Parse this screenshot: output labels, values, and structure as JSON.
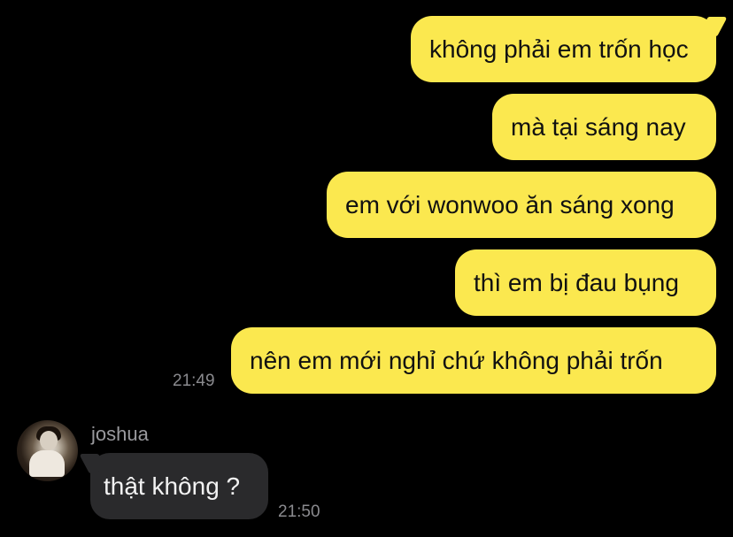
{
  "chat": {
    "outgoing": [
      {
        "text": "không phải em trốn học"
      },
      {
        "text": "mà tại sáng nay"
      },
      {
        "text": "em với wonwoo ăn sáng xong"
      },
      {
        "text": "thì em bị đau bụng"
      },
      {
        "text": "nên em mới nghỉ chứ không phải trốn"
      }
    ],
    "outgoing_time": "21:49",
    "incoming": {
      "sender": "joshua",
      "text": "thật không ?",
      "time": "21:50"
    }
  },
  "colors": {
    "background": "#000000",
    "outgoing_bubble": "#FBE84F",
    "incoming_bubble": "#2A2A2C",
    "timestamp": "#8A8A8E"
  },
  "icons": {
    "avatar": "profile-photo"
  }
}
